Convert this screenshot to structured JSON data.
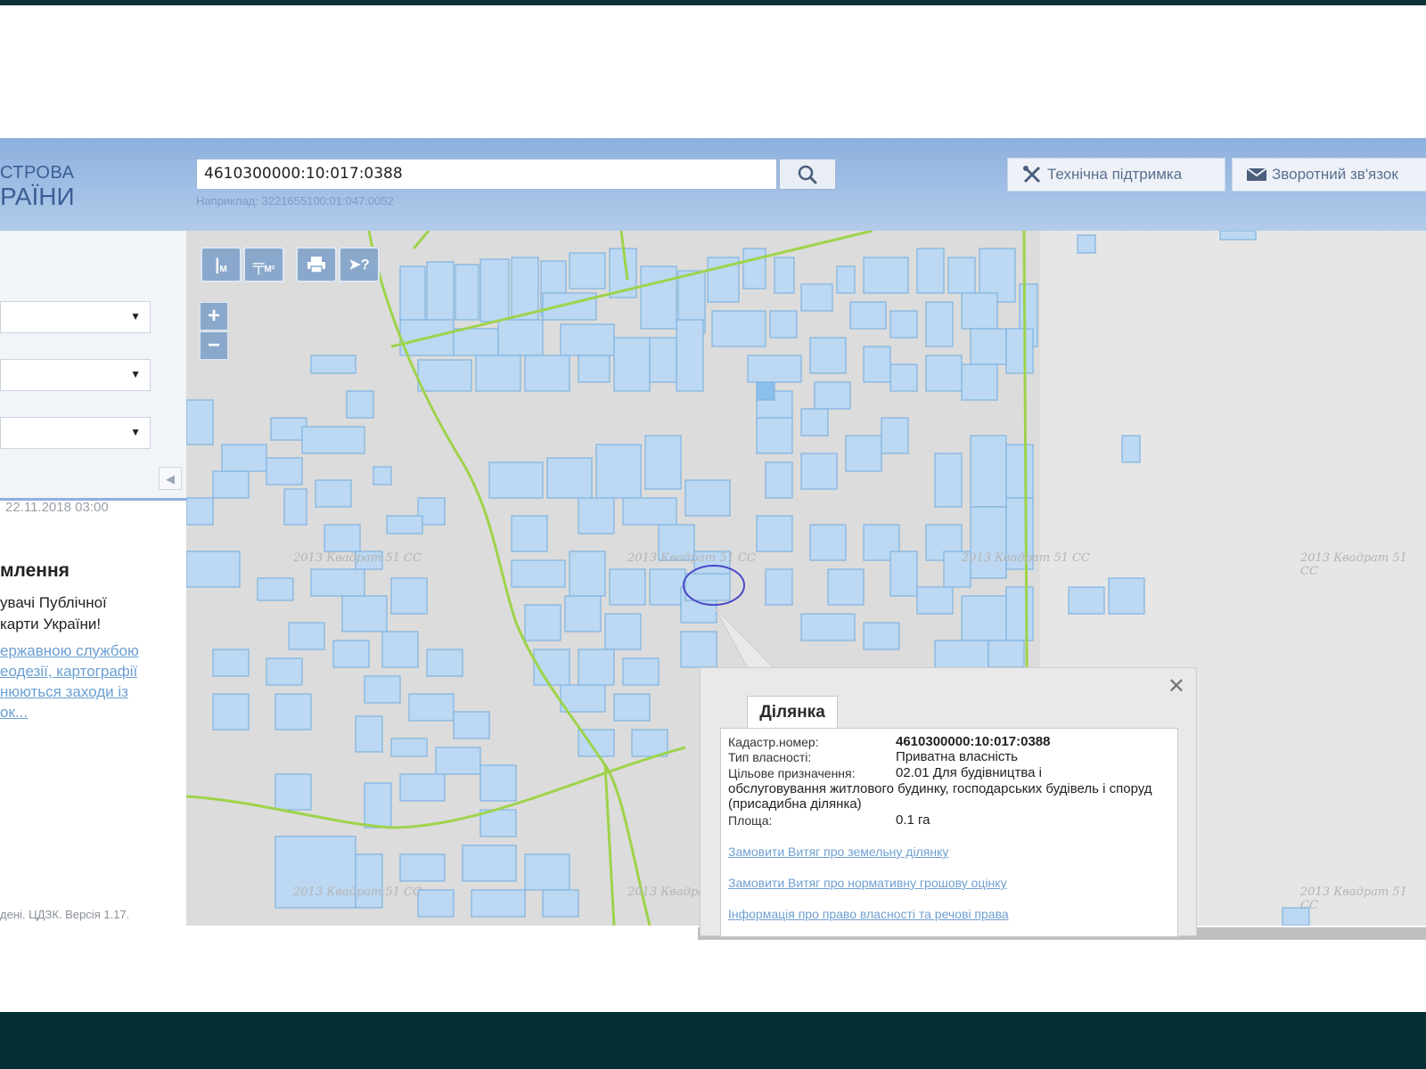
{
  "header": {
    "logo_line1": "СТРОВА",
    "logo_line2": "РАЇНИ",
    "search_value": "4610300000:10:017:0388",
    "search_hint": "Наприклад: 3221655100:01:047:0052",
    "support_label": "Технічна підтримка",
    "feedback_label": "Зворотний зв'язок"
  },
  "sidebar": {
    "date": "22.11.2018 03:00",
    "notice_title": "млення",
    "notice_line1": "увачі Публічної",
    "notice_line2": "карти України!",
    "link_line1": "ержавною  службою",
    "link_line2": "еодезії,  картографії",
    "link_line3": "нюються  заходи  із",
    "link_line4": "ок...",
    "footer": "дені. ЦДЗК. Версія 1.17."
  },
  "map": {
    "toolbar": {
      "ruler_label": "М",
      "area_label": "М²",
      "zoom_in": "+",
      "zoom_out": "−"
    },
    "watermarks": [
      "2013 Квадрат 51 СС",
      "2013 Квадрат 51 СС",
      "2013 Квадрат 51 СС",
      "2013 Квадрат 51 СС",
      "2013 Квадрат 51 СС",
      "2013 Квадрат 51 СС",
      "2013 Квадрат 51 СС"
    ]
  },
  "popup": {
    "close": "✕",
    "tab": "Ділянка",
    "cadastral_label": "Кадастр.номер:",
    "cadastral_value": "4610300000:10:017:0388",
    "ownership_label": "Тип власності:",
    "ownership_value": "Приватна власність",
    "purpose_label": "Цільове призначення:",
    "purpose_value": "02.01 Для будівництва і",
    "purpose_cont": "обслуговування житлового будинку, господарських будівель і споруд (присадибна ділянка)",
    "area_label": "Площа:",
    "area_value": "0.1 га",
    "link1": "Замовити Витяг про земельну ділянку",
    "link2": "Замовити Витяг про нормативну грошову оцінку",
    "link3": "Інформація про право власності та речові права"
  },
  "colors": {
    "header_blue": "#8db0de",
    "parcel_fill": "#bcd8f2",
    "parcel_stroke": "#7fb3e0",
    "road_green": "#9ed34b",
    "link_blue": "#6f9fd2"
  }
}
